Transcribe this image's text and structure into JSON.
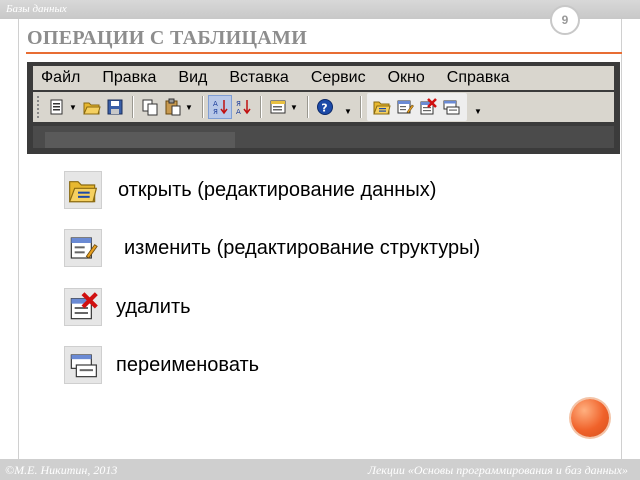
{
  "header": {
    "section": "Базы данных",
    "slide_number": "9",
    "title": "ОПЕРАЦИИ С ТАБЛИЦАМИ"
  },
  "app": {
    "menu": [
      "Файл",
      "Правка",
      "Вид",
      "Вставка",
      "Сервис",
      "Окно",
      "Справка"
    ],
    "toolbar_icons": [
      "view-icon",
      "folder-open-icon",
      "save-icon",
      "copy-icon",
      "paste-icon",
      "sort-ascending-icon",
      "sort-descending-icon",
      "form-icon",
      "help-icon"
    ],
    "highlighted_icons": [
      "open-table-icon",
      "design-table-icon",
      "delete-table-icon",
      "rename-table-icon"
    ]
  },
  "operations": [
    {
      "icon": "open-table-icon",
      "label": "открыть (редактирование данных)"
    },
    {
      "icon": "design-table-icon",
      "label": "изменить (редактирование структуры)"
    },
    {
      "icon": "delete-table-icon",
      "label": "удалить"
    },
    {
      "icon": "rename-table-icon",
      "label": "переименовать"
    }
  ],
  "footer": {
    "left": "©М.Е. Никитин, 2013",
    "right": "Лекции «Основы программирования и баз данных»"
  },
  "colors": {
    "accent_line": "#e86d34",
    "title_text": "#8d8d8d",
    "toolbar_bg": "#d9d6ce",
    "orange_ball": "#f0622a"
  }
}
